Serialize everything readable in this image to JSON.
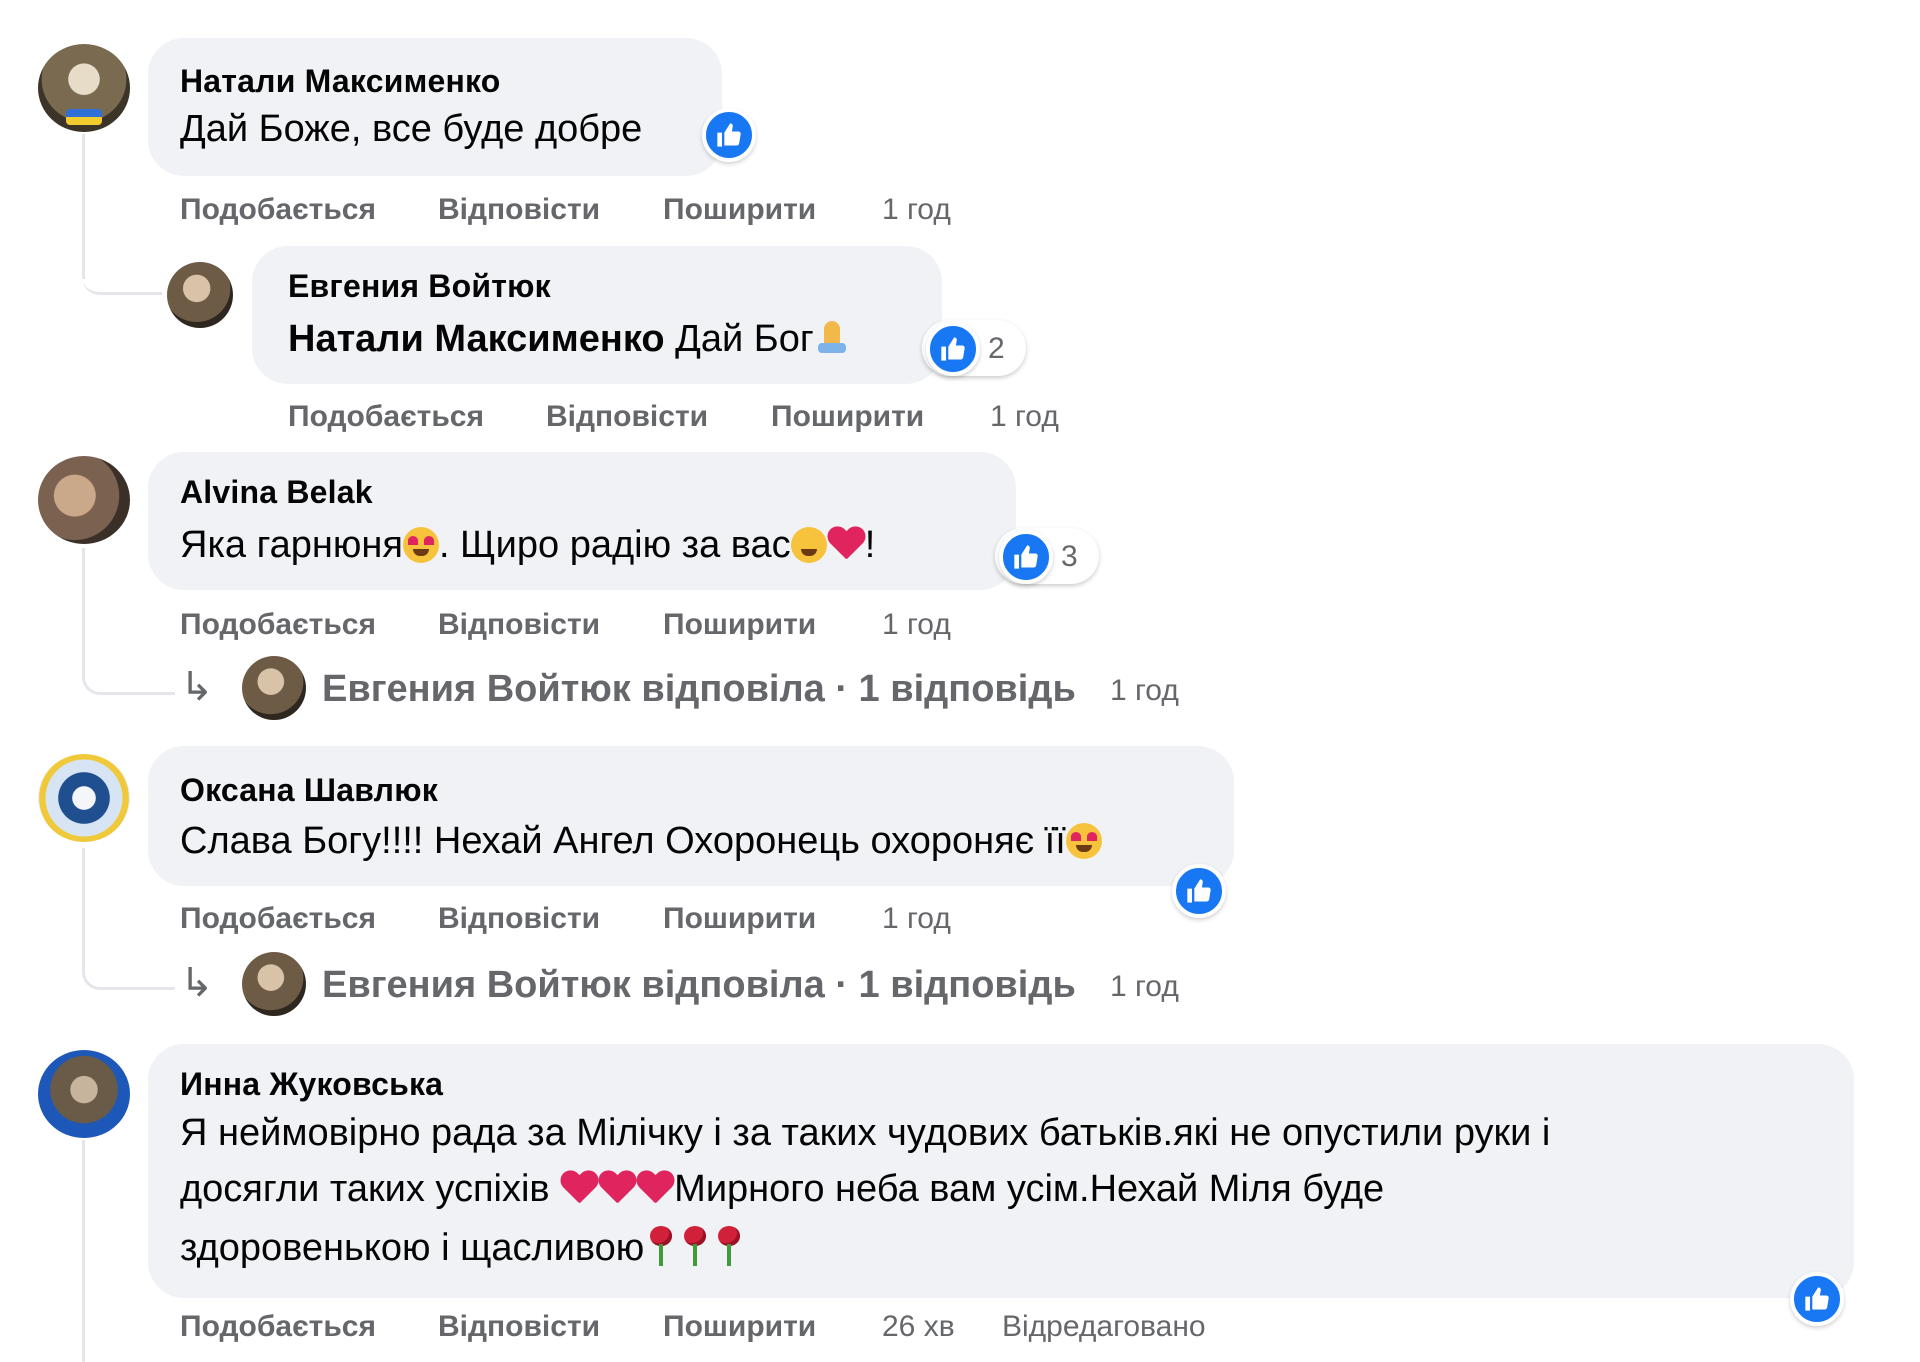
{
  "labels": {
    "like": "Подобається",
    "reply": "Відповісти",
    "share": "Поширити"
  },
  "comments": [
    {
      "author": "Натали Максименко",
      "text": "Дай Боже, все буде добре",
      "time": "1 год"
    },
    {
      "author": "Евгения Войтюк",
      "mention": "Натали Максименко",
      "text": " Дай Бог",
      "reactions": "2",
      "time": "1 год"
    },
    {
      "author": "Alvina Belak",
      "text_a": "Яка гарнюня",
      "text_b": ". Щиро радію за вас",
      "text_c": "!",
      "reactions": "3",
      "time": "1 год",
      "reply_summary": "Евгения Войтюк відповіла · 1 відповідь",
      "reply_time": "1 год"
    },
    {
      "author": "Оксана Шавлюк",
      "text": "Слава Богу!!!! Нехай Ангел Охоронець охороняє її",
      "time": "1 год",
      "reply_summary": "Евгения Войтюк відповіла · 1 відповідь",
      "reply_time": "1 год"
    },
    {
      "author": "Инна Жуковська",
      "line1": "Я неймовірно рада за Мілічку і за таких чудових батьків.які не опустили руки і",
      "line2a": "досягли таких успіхів ",
      "line2b": "Мирного неба вам усім.Нехай Міля буде",
      "line3": "здоровенькою і щасливою",
      "time": "26 хв",
      "edited": "Відредаговано"
    }
  ],
  "icons": {
    "reaction": "like-icon",
    "reply_arrow": "reply-arrow-icon"
  },
  "colors": {
    "like_blue": "#1877f2",
    "bubble": "#f0f2f5",
    "secondary_text": "#65676b"
  }
}
